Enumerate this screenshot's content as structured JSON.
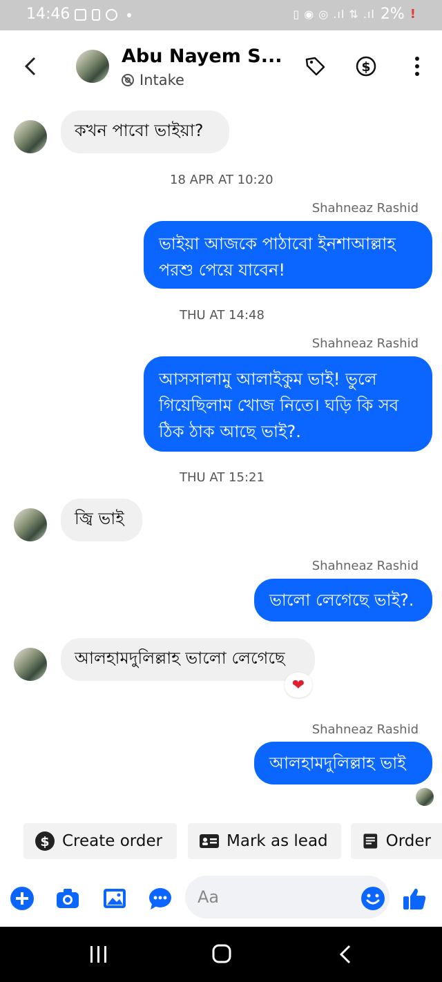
{
  "status_bar": {
    "time": "14:46",
    "battery": "2%",
    "battery_warning": "!"
  },
  "header": {
    "name": "Abu Nayem S...",
    "label": "Intake"
  },
  "messages": {
    "m1": "কখন পাবো ভাইয়া?",
    "ts1": "18 APR AT 10:20",
    "sender1": "Shahneaz Rashid",
    "m2_l1": "ভাইয়া আজকে পাঠাবো ইনশাআল্লাহ",
    "m2_l2": "পরশু পেয়ে যাবেন!",
    "ts2": "THU AT 14:48",
    "sender2": "Shahneaz Rashid",
    "m3_l1": "আসসালামু আলাইকুম ভাই! ভুলে",
    "m3_l2": "গিয়েছিলাম খোজ নিতে। ঘড়ি কি সব",
    "m3_l3": "ঠিক ঠাক আছে ভাই?.",
    "ts3": "THU AT 15:21",
    "m4": "জ্বি ভাই",
    "sender3": "Shahneaz Rashid",
    "m5": "ভালো লেগেছে ভাই?.",
    "m6": "আলহামদুলিল্লাহ ভালো লেগেছে",
    "m6_reaction": "❤",
    "sender4": "Shahneaz Rashid",
    "m7": "আলহামদুলিল্লাহ ভাই"
  },
  "actions": {
    "create_order": "Create order",
    "mark_as_lead": "Mark as lead",
    "order": "Order"
  },
  "composer": {
    "placeholder": "Aa"
  },
  "colors": {
    "accent": "#0a66ff",
    "incoming_bubble": "#f0f0f0",
    "status_bar": "#c9c9c9"
  }
}
